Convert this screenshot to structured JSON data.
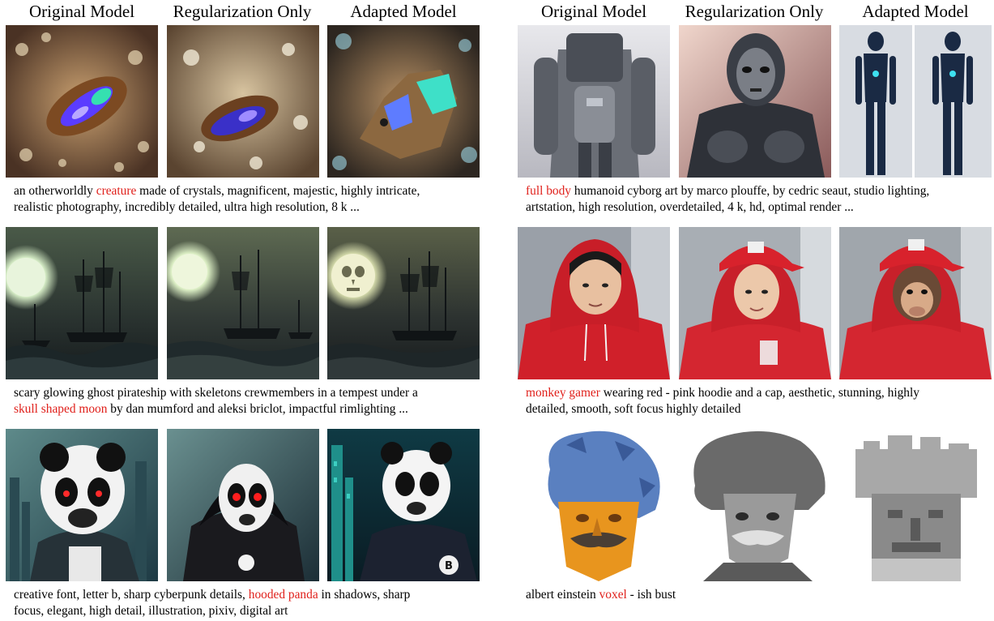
{
  "left": {
    "headers": [
      "Original Model",
      "Regularization Only",
      "Adapted Model"
    ],
    "rows": [
      {
        "subject": "crystal creature",
        "caption_lines": [
          [
            {
              "t": "an otherworldly "
            },
            {
              "t": "creature",
              "hl": true
            },
            {
              "t": " made of crystals, magnificent, majestic, highly intricate,"
            }
          ],
          [
            {
              "t": "realistic photography, incredibly detailed, ultra high resolution, 8 k ..."
            }
          ]
        ]
      },
      {
        "subject": "ghost pirate ships under a moon",
        "caption_lines": [
          [
            {
              "t": "scary glowing ghost pirateship with skeletons crewmembers in a tempest under a"
            }
          ],
          [
            {
              "t": "skull shaped moon",
              "hl": true
            },
            {
              "t": " by dan mumford and aleksi briclot, impactful rimlighting ..."
            }
          ]
        ]
      },
      {
        "subject": "panda in a hood, cyberpunk",
        "caption_lines": [
          [
            {
              "t": "creative font, letter b, sharp cyberpunk details, "
            },
            {
              "t": "hooded panda",
              "hl": true
            },
            {
              "t": " in shadows, sharp"
            }
          ],
          [
            {
              "t": "focus, elegant, high detail, illustration, pixiv, digital art"
            }
          ]
        ]
      }
    ]
  },
  "right": {
    "headers": [
      "Original Model",
      "Regularization Only",
      "Adapted Model"
    ],
    "rows": [
      {
        "subject": "humanoid cyborg",
        "caption_lines": [
          [
            {
              "t": "full body",
              "hl": true
            },
            {
              "t": " humanoid cyborg art by marco plouffe, by cedric seaut, studio lighting,"
            }
          ],
          [
            {
              "t": "artstation, high resolution, overdetailed, 4 k, hd, optimal render ..."
            }
          ]
        ]
      },
      {
        "subject": "person in red hoodie and cap",
        "caption_lines": [
          [
            {
              "t": "monkey gamer",
              "hl": true
            },
            {
              "t": " wearing red - pink hoodie and a cap, aesthetic, stunning, highly"
            }
          ],
          [
            {
              "t": "detailed, smooth, soft focus highly detailed"
            }
          ]
        ]
      },
      {
        "subject": "albert einstein bust",
        "caption_lines": [
          [
            {
              "t": "albert einstein "
            },
            {
              "t": "voxel",
              "hl": true
            },
            {
              "t": " - ish bust"
            }
          ]
        ]
      }
    ]
  },
  "colors": {
    "highlight": "#e0201b",
    "text": "#000000"
  }
}
